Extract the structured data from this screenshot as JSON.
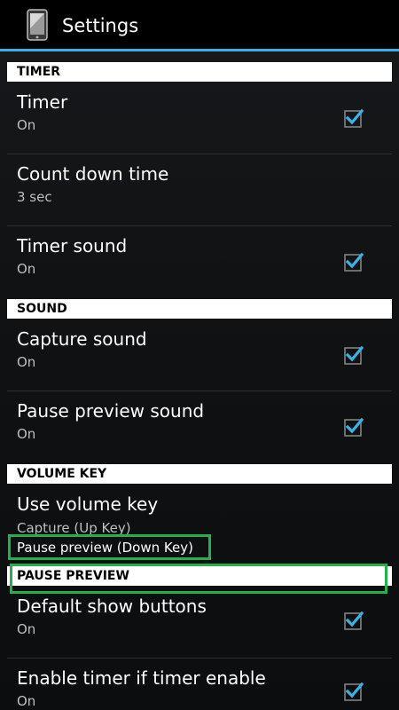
{
  "header": {
    "title": "Settings",
    "icon": "phone-app-icon"
  },
  "sections": [
    {
      "label": "TIMER",
      "items": [
        {
          "title": "Timer",
          "summary": "On",
          "checked": true
        },
        {
          "title": "Count down time",
          "summary": "3 sec",
          "checked": null
        },
        {
          "title": "Timer sound",
          "summary": "On",
          "checked": true
        }
      ]
    },
    {
      "label": "SOUND",
      "items": [
        {
          "title": "Capture sound",
          "summary": "On",
          "checked": true
        },
        {
          "title": "Pause preview sound",
          "summary": "On",
          "checked": true
        }
      ]
    },
    {
      "label": "VOLUME KEY",
      "items": [
        {
          "title": "Use volume key",
          "summary_lines": [
            "Capture (Up Key)",
            "Pause preview (Down Key)"
          ],
          "checked": null
        }
      ]
    },
    {
      "label": "PAUSE PREVIEW",
      "items": [
        {
          "title": "Default show buttons",
          "summary": "On",
          "checked": true
        },
        {
          "title": "Enable timer if timer enable",
          "summary": "On",
          "checked": true
        }
      ]
    }
  ],
  "colors": {
    "accent": "#33b5e5",
    "highlight": "#22b14c",
    "header_bg": "#ffffff",
    "background": "#101214"
  }
}
